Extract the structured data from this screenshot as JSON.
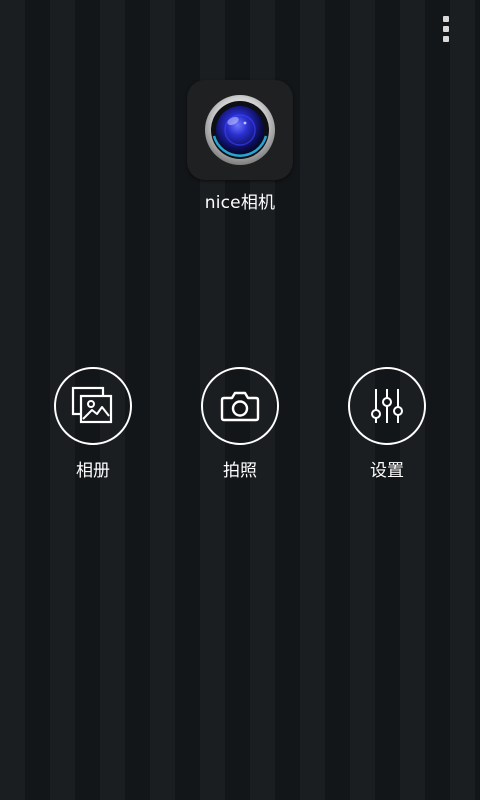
{
  "app": {
    "name": "nice相机",
    "icon": "camera-lens-icon"
  },
  "menu": {
    "icon": "overflow-menu-icon"
  },
  "actions": [
    {
      "label": "相册",
      "icon": "gallery-icon"
    },
    {
      "label": "拍照",
      "icon": "camera-icon"
    },
    {
      "label": "设置",
      "icon": "sliders-settings-icon"
    }
  ],
  "colors": {
    "background_stripe_light": "#1b1e21",
    "background_stripe_dark": "#131619",
    "foreground": "#ffffff",
    "lens_blue": "#2a2fd0"
  }
}
